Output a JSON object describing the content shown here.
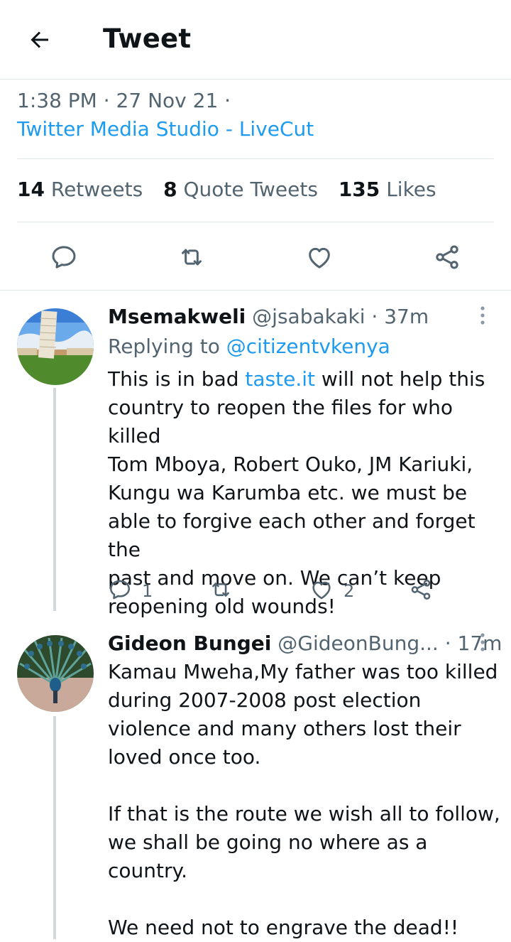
{
  "header": {
    "title": "Tweet"
  },
  "tweet": {
    "time": "1:38 PM",
    "date": "27 Nov 21",
    "source": "Twitter Media Studio - LiveCut",
    "stats": [
      {
        "count": "14",
        "label": "Retweets"
      },
      {
        "count": "8",
        "label": "Quote Tweets"
      },
      {
        "count": "135",
        "label": "Likes"
      }
    ]
  },
  "icons": {
    "back": "arrow-left-icon",
    "reply": "reply-icon",
    "retweet": "retweet-icon",
    "like": "heart-icon",
    "share": "share-icon",
    "more": "more-vertical-icon"
  },
  "replies": [
    {
      "name": "Msemakweli",
      "handle": "@jsabakaki",
      "time": "37m",
      "replying_prefix": "Replying to",
      "replying_to": "@citizentvkenya",
      "text_before_link": "This is in bad ",
      "link_text": "taste.it",
      "lines_after_link": [
        " will not help this",
        "country to reopen the files for who killed",
        "Tom Mboya, Robert Ouko, JM Kariuki,",
        "Kungu wa Karumba etc. we must be",
        "able to forgive each other and forget the",
        "past and move on. We can’t keep",
        "reopening old wounds!"
      ],
      "reply_count": "1",
      "retweet_count": "",
      "like_count": "2"
    },
    {
      "name": "Gideon Bungei",
      "handle": "@GideonBung...",
      "time": "17m",
      "lines": [
        "Kamau Mweha,My father was too killed",
        "during 2007-2008 post election",
        "violence and many others lost their",
        "loved once too.",
        "",
        "If that is the route we wish all to follow,",
        "we shall be going no where as a country.",
        "",
        "We  need not to engrave the dead!!"
      ]
    }
  ],
  "colors": {
    "accent": "#1d9bf0",
    "text": "#0f1419",
    "muted": "#536471",
    "border": "#e1e6ea"
  }
}
